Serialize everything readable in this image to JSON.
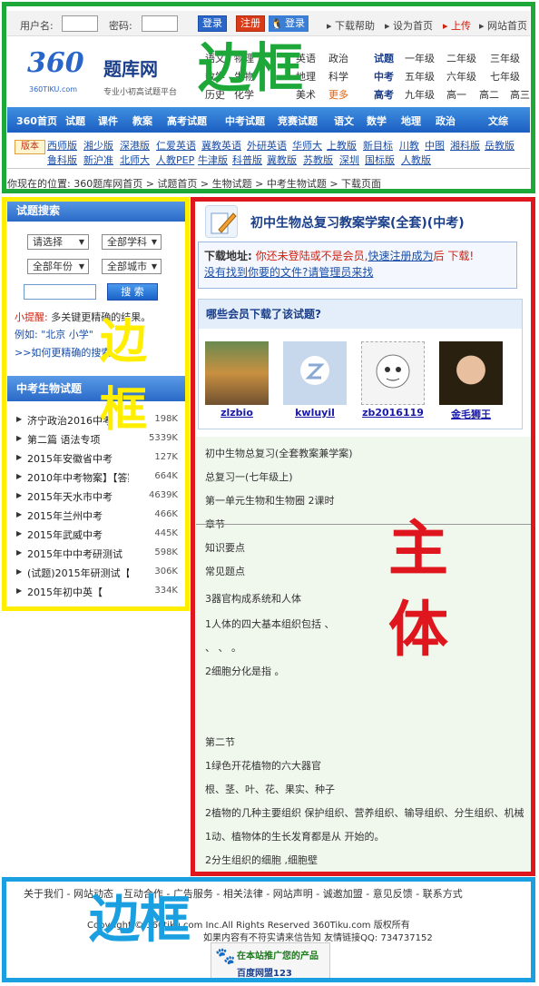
{
  "topbar": {
    "username_label": "用户名:",
    "password_label": "密码:",
    "login_btn": "登录",
    "register_btn": "注册",
    "qq_login": "登录",
    "links": [
      "下载帮助",
      "设为首页",
      "上传",
      "网站首页"
    ]
  },
  "logo": {
    "brand": "360",
    "name": "题库网",
    "sub": "专业小初高试题平台",
    "url": "360TIKU.com"
  },
  "subjects": {
    "col1": [
      "语文",
      "数学",
      "英语",
      "政治"
    ],
    "col2": [
      "物理",
      "化学",
      "地理",
      "科学"
    ],
    "col3": [
      "历史",
      "生物",
      "美术",
      "更多"
    ],
    "grades_label": [
      "试题",
      "中考",
      "高考"
    ],
    "grades_row1": [
      "一年级",
      "二年级",
      "三年级"
    ],
    "grades_row2": [
      "五年级",
      "六年级",
      "七年级"
    ],
    "grades_row3": [
      "九年级",
      "高一",
      "高二",
      "高三"
    ]
  },
  "nav": [
    "360首页",
    "试题",
    "课件",
    "教案",
    "高考试题",
    "中考试题",
    "竞赛试题",
    "语文",
    "数学",
    "地理",
    "政治",
    "文综"
  ],
  "versions": {
    "badge": "版本",
    "row1": [
      "西师版",
      "湘少版",
      "深港版",
      "仁爱英语",
      "冀教英语",
      "外研英语",
      "华师大",
      "上教版",
      "新目标",
      "川教",
      "中图",
      "湘科版",
      "岳教版"
    ],
    "row2": [
      "鲁科版",
      "新沪准",
      "北师大",
      "人教PEP",
      "牛津版",
      "科普版",
      "冀教版",
      "苏教版",
      "深圳",
      "国标版",
      "人教版"
    ]
  },
  "breadcrumb": "你现在的位置: 360题库网首页 > 试题首页 > 生物试题 > 中考生物试题 > 下载页面",
  "sidebar": {
    "search_title": "试题搜索",
    "selects": [
      "请选择",
      "全部学科",
      "全部年份",
      "全部城市"
    ],
    "search_btn": "搜 索",
    "tip_label": "小提醒:",
    "tip_text": "多关键更精确的结果。",
    "example": "例如: \"北京 小学\"",
    "more_link": ">>如何更精确的搜索",
    "list_title": "中考生物试题",
    "items": [
      {
        "title": "济宁政治2016中考",
        "size": "198K"
      },
      {
        "title": "第二篇 语法专项",
        "size": "5339K"
      },
      {
        "title": "2015年安徽省中考",
        "size": "127K"
      },
      {
        "title": "2010年中考物案】【答案",
        "size": "664K"
      },
      {
        "title": "2015年天水市中考",
        "size": "4639K"
      },
      {
        "title": "2015年兰州中考",
        "size": "466K"
      },
      {
        "title": "2015年武威中考",
        "size": "445K"
      },
      {
        "title": "2015年中中考研测试【答",
        "size": "598K"
      },
      {
        "title": "(试题)2015年研测试【",
        "size": "306K"
      },
      {
        "title": "2015年初中英【",
        "size": "334K"
      }
    ]
  },
  "main": {
    "title": "初中生物总复习教案学案(全套)(中考)",
    "download_label": "下载地址:",
    "download_msg": "你还未登陆或不是会员,",
    "register_link": "快速注册成为",
    "after": "后",
    "download_word": "下载!",
    "contact_link": "没有找到你要的文件?请管理员来找",
    "members_title": "哪些会员下载了该试题?",
    "members": [
      "zlzbio",
      "kwluyil",
      "zb2016119",
      "金毛狮王"
    ],
    "lines": [
      "初中生物总复习(全套教案兼学案)",
      "总复习一(七年级上)",
      "第一单元生物和生物圈 2课时",
      "章节",
      "知识要点",
      "常见题点",
      "3器官构成系统和人体",
      "1人体的四大基本组织包括 、",
      "、 、 。",
      "2细胞分化是指 。",
      "第二节",
      "1绿色开花植物的六大器官",
      "根、茎、叶、花、果实、种子",
      "2植物的几种主要组织 保护组织、营养组织、输导组织、分生组织、机械",
      "1动、植物体的生长发育都是从 开始的。",
      "2分生组织的细胞 ,细胞壁"
    ]
  },
  "footer": {
    "links": "关于我们 - 网站动态 - 互动合作 - 广告服务 - 相关法律 - 网站声明 - 诚邀加盟 - 意见反馈 - 联系方式",
    "copyright": "Copyright © 360tiku.com Inc.All Rights Reserved 360Tiku.com 版权所有",
    "notice": "如果内容有不符实请来信告知 友情链接QQ: 734737152",
    "promo": "在本站推广您的产品",
    "promo2": "百度网盟123"
  },
  "overlays": {
    "green": "边框",
    "yellow": "边框",
    "red": "主体",
    "blue": "边框"
  },
  "colors": {
    "green": "#1fa83a",
    "yellow": "#ffee00",
    "red": "#e0161e",
    "blue": "#1aa0e0"
  }
}
